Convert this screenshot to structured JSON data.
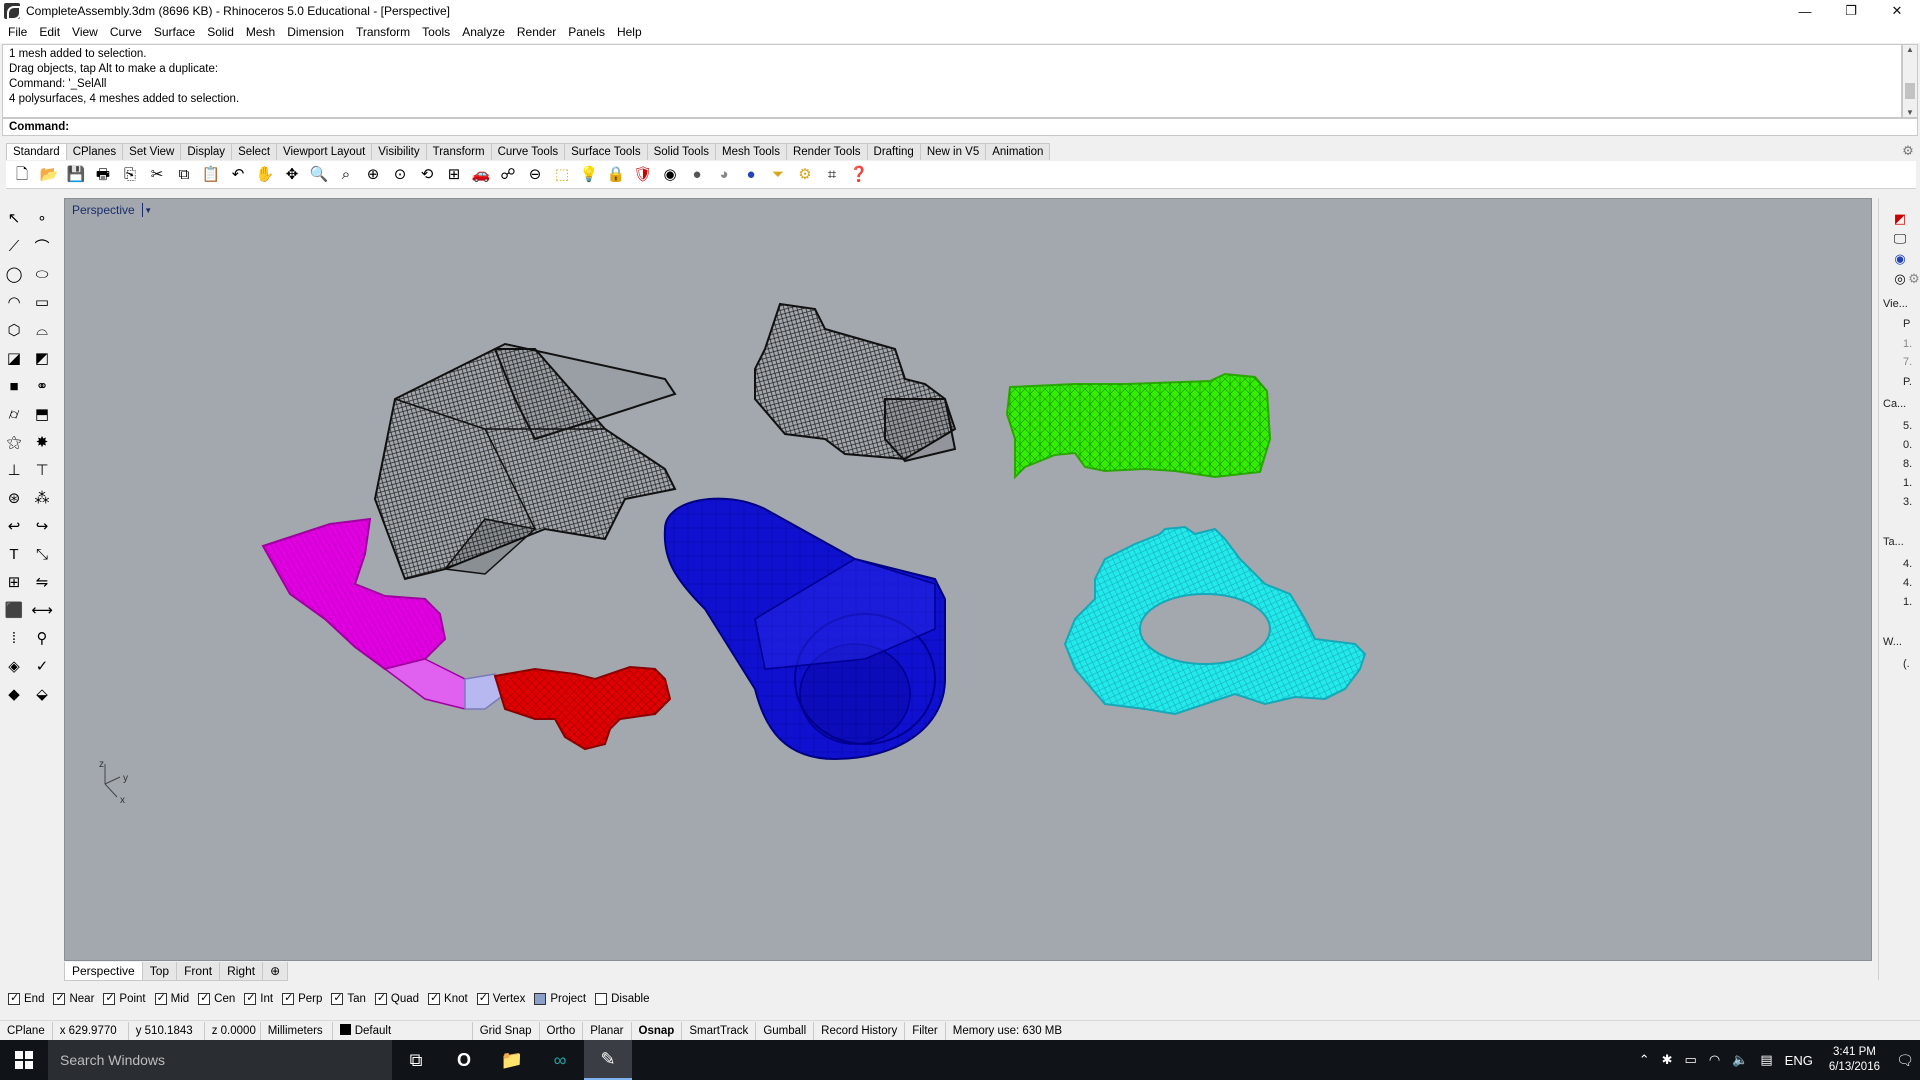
{
  "window": {
    "title": "CompleteAssembly.3dm (8696 KB) - Rhinoceros 5.0 Educational - [Perspective]",
    "minimize_glyph": "—",
    "restore_glyph": "❐",
    "close_glyph": "✕"
  },
  "menu": [
    "File",
    "Edit",
    "View",
    "Curve",
    "Surface",
    "Solid",
    "Mesh",
    "Dimension",
    "Transform",
    "Tools",
    "Analyze",
    "Render",
    "Panels",
    "Help"
  ],
  "command_history": [
    "1 mesh added to selection.",
    "Drag objects, tap Alt to make a duplicate:",
    "Command: '_SelAll",
    "4 polysurfaces, 4 meshes added to selection."
  ],
  "command_prompt": {
    "label": "Command:",
    "value": ""
  },
  "toolbar_tabs": [
    "Standard",
    "CPlanes",
    "Set View",
    "Display",
    "Select",
    "Viewport Layout",
    "Visibility",
    "Transform",
    "Curve Tools",
    "Surface Tools",
    "Solid Tools",
    "Mesh Tools",
    "Render Tools",
    "Drafting",
    "New in V5",
    "Animation"
  ],
  "toolbar_icons": [
    "new-icon",
    "open-icon",
    "save-icon",
    "print-icon",
    "import-icon",
    "cut-icon",
    "copy-icon",
    "paste-icon",
    "undo-icon",
    "pan-icon",
    "move-icon",
    "zoom-window-icon",
    "zoom-dynamic-icon",
    "zoom-extents-icon",
    "zoom-selected-icon",
    "rotate-view-icon",
    "four-viewports-icon",
    "car-icon",
    "wireframe-icon",
    "osnap-icon",
    "cplane-icon",
    "light-icon",
    "lock-icon",
    "render-tool-icon",
    "color-wheel-icon",
    "material-ball-icon",
    "shade-icon",
    "render-icon",
    "filter-icon",
    "options-icon",
    "dimension-icon",
    "help-icon"
  ],
  "viewport": {
    "name": "Perspective",
    "axis_labels": {
      "z": "z",
      "y": "y",
      "x": "x"
    }
  },
  "view_tabs": [
    "Perspective",
    "Top",
    "Front",
    "Right"
  ],
  "view_tab_add": "⊕",
  "right_panel": {
    "labels": [
      "Vie...",
      "P",
      "1.",
      "7.",
      "P.",
      "Ca...",
      "5.",
      "0.",
      "8.",
      "1.",
      "3.",
      "Ta...",
      "4.",
      "4.",
      "1.",
      "W...",
      "(."
    ]
  },
  "osnap": [
    {
      "label": "End",
      "checked": true
    },
    {
      "label": "Near",
      "checked": true
    },
    {
      "label": "Point",
      "checked": true
    },
    {
      "label": "Mid",
      "checked": true
    },
    {
      "label": "Cen",
      "checked": true
    },
    {
      "label": "Int",
      "checked": true
    },
    {
      "label": "Perp",
      "checked": true
    },
    {
      "label": "Tan",
      "checked": true
    },
    {
      "label": "Quad",
      "checked": true
    },
    {
      "label": "Knot",
      "checked": true
    },
    {
      "label": "Vertex",
      "checked": true
    },
    {
      "label": "Project",
      "checked": false,
      "partial": true
    },
    {
      "label": "Disable",
      "checked": false
    }
  ],
  "status": {
    "cplane": "CPlane",
    "x": "x 629.9770",
    "y": "y 510.1843",
    "z": "z 0.0000",
    "units": "Millimeters",
    "layer": "Default",
    "grid_snap": "Grid Snap",
    "ortho": "Ortho",
    "planar": "Planar",
    "osnap": "Osnap",
    "smarttrack": "SmartTrack",
    "gumball": "Gumball",
    "record_history": "Record History",
    "filter": "Filter",
    "memory": "Memory use: 630 MB"
  },
  "taskbar": {
    "search_placeholder": "Search Windows",
    "language": "ENG",
    "time": "3:41 PM",
    "date": "6/13/2016"
  },
  "colors": {
    "viewport_bg": "#a3a8ae",
    "magenta": "#e000e0",
    "red": "#e00000",
    "blue": "#1010d0",
    "green": "#33ee00",
    "cyan": "#22eaea",
    "wireframe": "#1a1a1a"
  }
}
